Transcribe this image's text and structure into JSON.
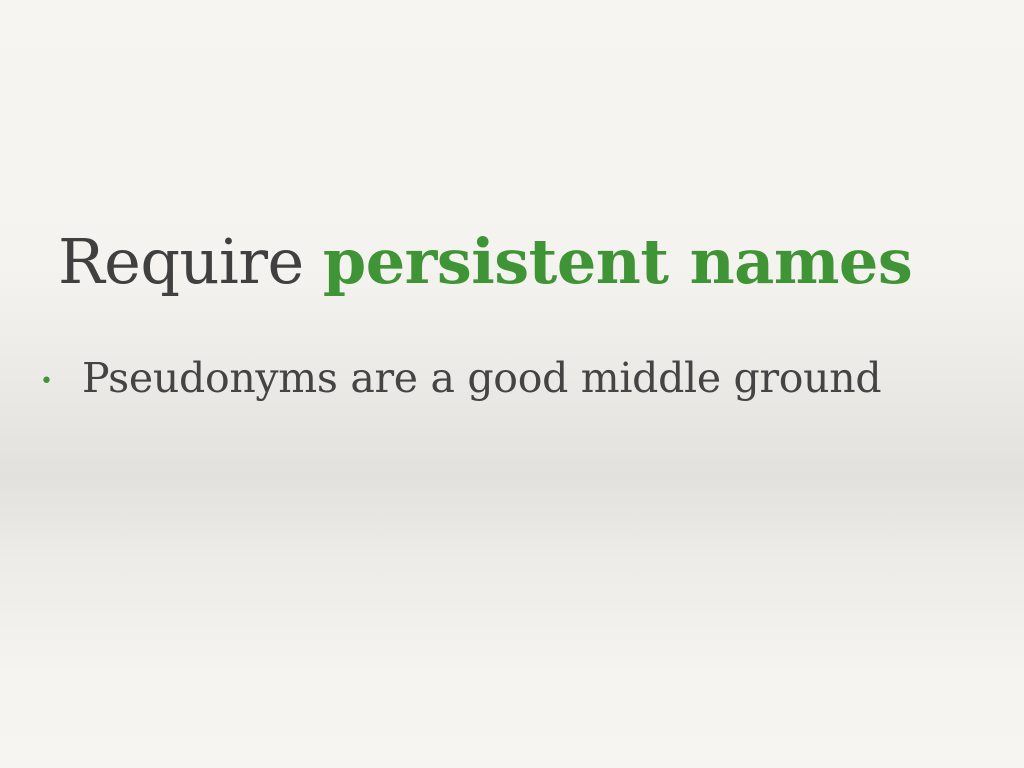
{
  "slide": {
    "title_plain": "Require ",
    "title_accent": "persistent names",
    "accent_color": "#3f9435",
    "text_color": "#404040",
    "bullets": [
      {
        "marker": "•",
        "text": "Pseudonyms are a good middle ground"
      }
    ]
  }
}
